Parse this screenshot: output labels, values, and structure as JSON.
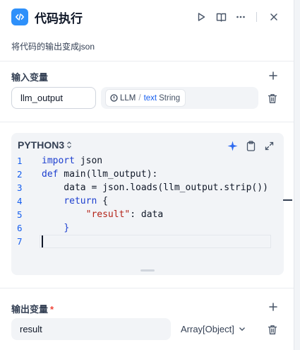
{
  "header": {
    "title": "代码执行",
    "description": "将代码的输出变成json"
  },
  "input_section": {
    "label": "输入变量",
    "variable_name": "llm_output",
    "source_node": "LLM",
    "source_separator": "/",
    "source_variable": "text",
    "source_type": "String"
  },
  "code_editor": {
    "language": "PYTHON3",
    "line_numbers": [
      "1",
      "2",
      "3",
      "4",
      "5",
      "6",
      "7"
    ],
    "lines": [
      "import json",
      "def main(llm_output):",
      "    data = json.loads(llm_output.strip())",
      "    return {",
      "        \"result\": data",
      "    }",
      ""
    ]
  },
  "output_section": {
    "label": "输出变量",
    "required_mark": "*",
    "variable_name": "result",
    "variable_type": "Array[Object]"
  },
  "colors": {
    "accent": "#2e90fa",
    "keyword": "#1d3fcf",
    "string": "#b42318",
    "required": "#f04438"
  }
}
